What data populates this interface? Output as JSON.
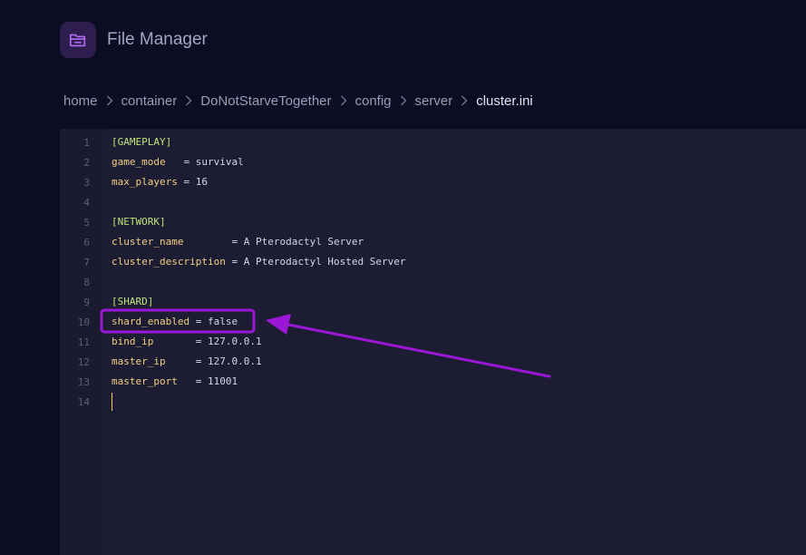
{
  "header": {
    "title": "File Manager",
    "icon": "folder-open-icon",
    "icon_bg": "#2e1d4f",
    "icon_color": "#b06cf0"
  },
  "breadcrumb": {
    "items": [
      "home",
      "container",
      "DoNotStarveTogether",
      "config",
      "server",
      "cluster.ini"
    ],
    "separator_icon": "chevron-right-icon"
  },
  "editor": {
    "line_numbers": [
      "1",
      "2",
      "3",
      "4",
      "5",
      "6",
      "7",
      "8",
      "9",
      "10",
      "11",
      "12",
      "13",
      "14"
    ],
    "lines": [
      {
        "type": "section",
        "text": "[GAMEPLAY]"
      },
      {
        "type": "kv",
        "key": "game_mode",
        "op": "   = ",
        "value": "survival"
      },
      {
        "type": "kv",
        "key": "max_players",
        "op": " = ",
        "value": "16"
      },
      {
        "type": "empty"
      },
      {
        "type": "section",
        "text": "[NETWORK]"
      },
      {
        "type": "kv",
        "key": "cluster_name",
        "op": "        = ",
        "value": "A Pterodactyl Server"
      },
      {
        "type": "kv",
        "key": "cluster_description",
        "op": " = ",
        "value": "A Pterodactyl Hosted Server"
      },
      {
        "type": "empty"
      },
      {
        "type": "section",
        "text": "[SHARD]"
      },
      {
        "type": "kv",
        "key": "shard_enabled",
        "op": " = ",
        "value": "false"
      },
      {
        "type": "kv",
        "key": "bind_ip",
        "op": "       = ",
        "value": "127.0.0.1"
      },
      {
        "type": "kv",
        "key": "master_ip",
        "op": "     = ",
        "value": "127.0.0.1"
      },
      {
        "type": "kv",
        "key": "master_port",
        "op": "   = ",
        "value": "11001"
      },
      {
        "type": "empty"
      }
    ],
    "colors": {
      "section": "#bfe37a",
      "key": "#f4cf86",
      "value": "#d4d6e4",
      "line_number": "#5b5e78",
      "cursor": "#f1c75a"
    }
  },
  "annotation": {
    "highlight_line": 10,
    "color": "#9b17d6"
  }
}
